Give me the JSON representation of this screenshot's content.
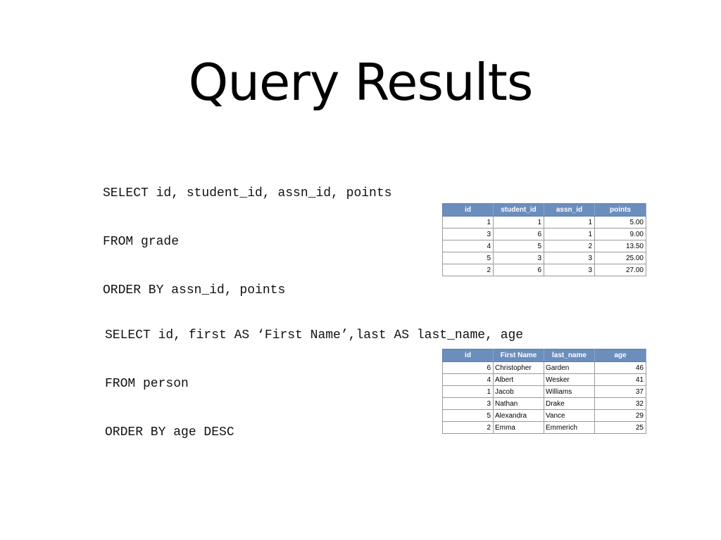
{
  "title": "Query Results",
  "query1": {
    "lines": [
      "SELECT id, student_id, assn_id, points",
      "FROM grade",
      "ORDER BY assn_id, points"
    ],
    "table": {
      "headers": [
        "id",
        "student_id",
        "assn_id",
        "points"
      ],
      "rows": [
        [
          "1",
          "1",
          "1",
          "5.00"
        ],
        [
          "3",
          "6",
          "1",
          "9.00"
        ],
        [
          "4",
          "5",
          "2",
          "13.50"
        ],
        [
          "5",
          "3",
          "3",
          "25.00"
        ],
        [
          "2",
          "6",
          "3",
          "27.00"
        ]
      ]
    }
  },
  "query2": {
    "lines": [
      "SELECT id, first AS ‘First Name’,last AS last_name, age",
      "FROM person",
      "ORDER BY age DESC"
    ],
    "table": {
      "headers": [
        "id",
        "First Name",
        "last_name",
        "age"
      ],
      "rows": [
        [
          "6",
          "Christopher",
          "Garden",
          "46"
        ],
        [
          "4",
          "Albert",
          "Wesker",
          "41"
        ],
        [
          "1",
          "Jacob",
          "Williams",
          "37"
        ],
        [
          "3",
          "Nathan",
          "Drake",
          "32"
        ],
        [
          "5",
          "Alexandra",
          "Vance",
          "29"
        ],
        [
          "2",
          "Emma",
          "Emmerich",
          "25"
        ]
      ]
    }
  },
  "colors": {
    "header_bg": "#6b8ebd",
    "header_text": "#ffffff",
    "cell_border": "#9a9a9a"
  }
}
